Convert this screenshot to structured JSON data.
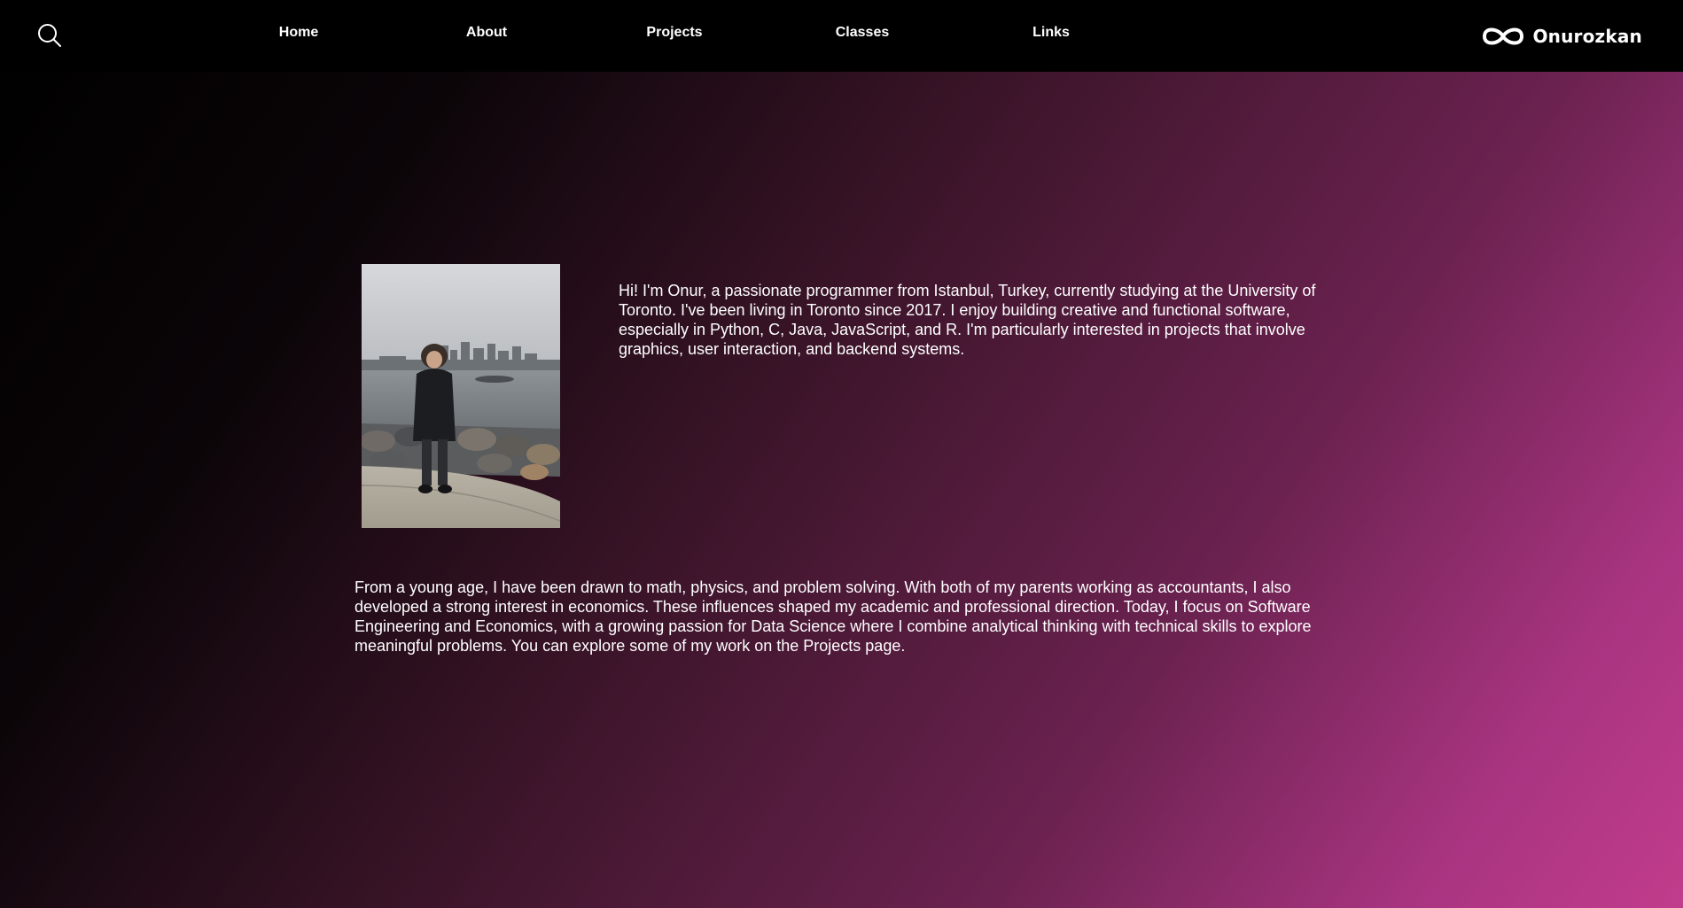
{
  "header": {
    "search_icon": "search-icon",
    "nav": [
      {
        "label": "Home"
      },
      {
        "label": "About"
      },
      {
        "label": "Projects"
      },
      {
        "label": "Classes"
      },
      {
        "label": "Links"
      }
    ],
    "brand": {
      "logo_icon": "infinity-icon",
      "name": "Onurozkan"
    }
  },
  "main": {
    "intro": "Hi! I'm Onur, a passionate programmer from Istanbul, Turkey, currently studying at the University of Toronto. I've been living in Toronto since 2017. I enjoy building creative and functional software, especially in Python, C, Java, JavaScript, and R. I'm particularly interested in projects that involve graphics, user interaction, and backend systems.",
    "bio": "From a young age, I have been drawn to math, physics, and problem solving. With both of my parents working as accountants, I also developed a strong interest in economics. These influences shaped my academic and professional direction. Today, I focus on Software Engineering and Economics, with a growing passion for Data Science where I combine analytical thinking with technical skills to explore meaningful problems. You can explore some of my work on the Projects page."
  },
  "colors": {
    "header_bg": "#000000",
    "gradient_start": "#000000",
    "gradient_end": "#c13c8c",
    "text": "#ffffff"
  }
}
